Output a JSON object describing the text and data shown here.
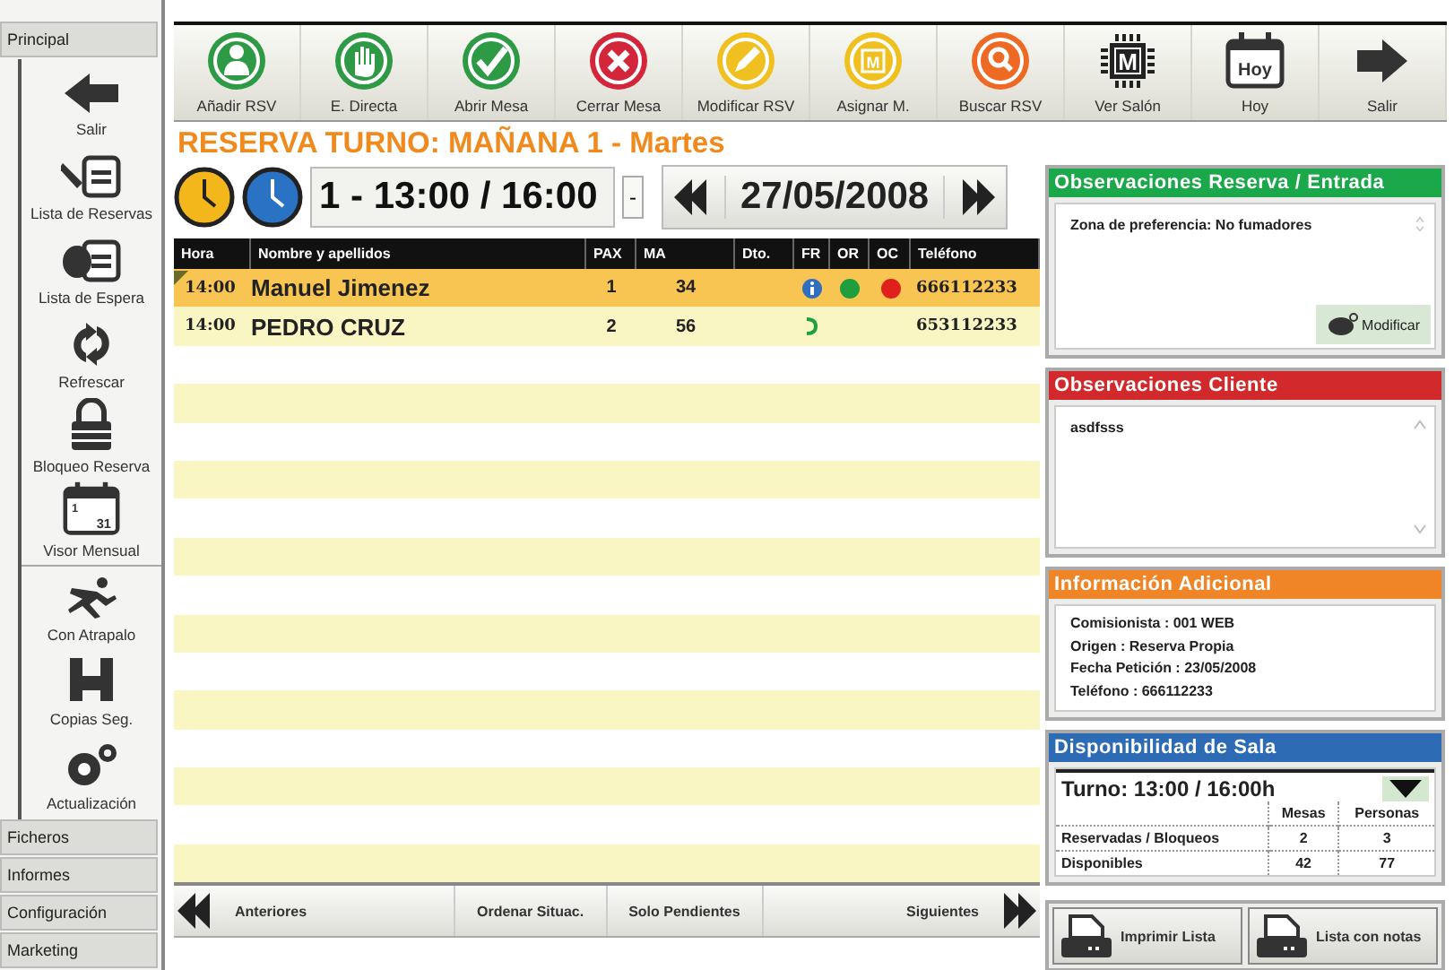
{
  "sidebar": {
    "header": "Principal",
    "items": [
      {
        "label": "Salir",
        "kind": "arrow-left"
      },
      {
        "label": "Lista de Reservas",
        "kind": "pen-list"
      },
      {
        "label": "Lista de Espera",
        "kind": "hand-list"
      },
      {
        "label": "Refrescar",
        "kind": "refresh"
      },
      {
        "label": "Bloqueo Reserva",
        "kind": "lock"
      },
      {
        "label": "Visor Mensual",
        "kind": "calendar",
        "icon_texts": [
          "1",
          "31"
        ]
      },
      {
        "label": "Con Atrapalo",
        "kind": "runner"
      },
      {
        "label": "Copias Seg.",
        "kind": "disk"
      },
      {
        "label": "Actualización",
        "kind": "gears"
      }
    ],
    "groups": [
      "Ficheros",
      "Informes",
      "Configuración",
      "Marketing"
    ]
  },
  "toolbar": [
    {
      "label": "Añadir RSV",
      "kind": "person",
      "color": "#2e9a45"
    },
    {
      "label": "E. Directa",
      "kind": "hand",
      "color": "#2e9a45"
    },
    {
      "label": "Abrir Mesa",
      "kind": "check",
      "color": "#2e9a45"
    },
    {
      "label": "Cerrar Mesa",
      "kind": "cross",
      "color": "#d3263a"
    },
    {
      "label": "Modificar RSV",
      "kind": "pencil",
      "color": "#f0c020"
    },
    {
      "label": "Asignar M.",
      "kind": "chip",
      "color": "#f0c020",
      "icon_text": "M"
    },
    {
      "label": "Buscar RSV",
      "kind": "search",
      "color": "#ee6a24"
    },
    {
      "label": "Ver Salón",
      "kind": "chip-dark",
      "icon_text": "M"
    },
    {
      "label": "Hoy",
      "kind": "calendar",
      "icon_text": "Hoy"
    },
    {
      "label": "Salir",
      "kind": "arrow-right"
    }
  ],
  "reservation": {
    "title": "RESERVA TURNO: MAÑANA 1 - Martes",
    "shift": "1 - 13:00 / 16:00",
    "shift_button": "-",
    "date": "27/05/2008",
    "table": {
      "columns": [
        "Hora",
        "Nombre y apellidos",
        "PAX",
        "MA",
        "Dto.",
        "FR",
        "OR",
        "OC",
        "Teléfono"
      ],
      "rows": [
        {
          "hora": "14:00",
          "nombre": "Manuel Jimenez",
          "pax": "1",
          "ma": "34",
          "fr": {
            "kind": "info"
          },
          "or": {
            "color": "#1e9e3c"
          },
          "oc": {
            "color": "#e0201c"
          },
          "telefono": "666112233",
          "selected": true,
          "flagged": true
        },
        {
          "hora": "14:00",
          "nombre": "PEDRO CRUZ",
          "pax": "2",
          "ma": "56",
          "fr": {
            "kind": "phone"
          },
          "telefono": "653112233",
          "selected": false,
          "flagged": false
        }
      ]
    },
    "footer": [
      "Anteriores",
      "Ordenar Situac.",
      "Solo Pendientes",
      "Siguientes"
    ]
  },
  "panels": {
    "obs_reserva": {
      "title": "Observaciones Reserva / Entrada",
      "text": "Zona de preferencia: No fumadores",
      "button": "Modificar"
    },
    "obs_cliente": {
      "title": "Observaciones Cliente",
      "text": "asdfsss"
    },
    "info": {
      "title": "Información Adicional",
      "lines": [
        "Comisionista : 001 WEB",
        "Origen : Reserva Propia",
        "Fecha Petición : 23/05/2008",
        "Teléfono : 666112233"
      ]
    },
    "disponibilidad": {
      "title": "Disponibilidad de Sala",
      "turno": "Turno:  13:00 / 16:00h",
      "columns": [
        "Mesas",
        "Personas"
      ],
      "rows": [
        {
          "label": "Reservadas / Bloqueos",
          "values": [
            "2",
            "3"
          ]
        },
        {
          "label": "Disponibles",
          "values": [
            "42",
            "77"
          ]
        }
      ]
    },
    "print_buttons": [
      "Imprimir Lista",
      "Lista con notas"
    ]
  }
}
